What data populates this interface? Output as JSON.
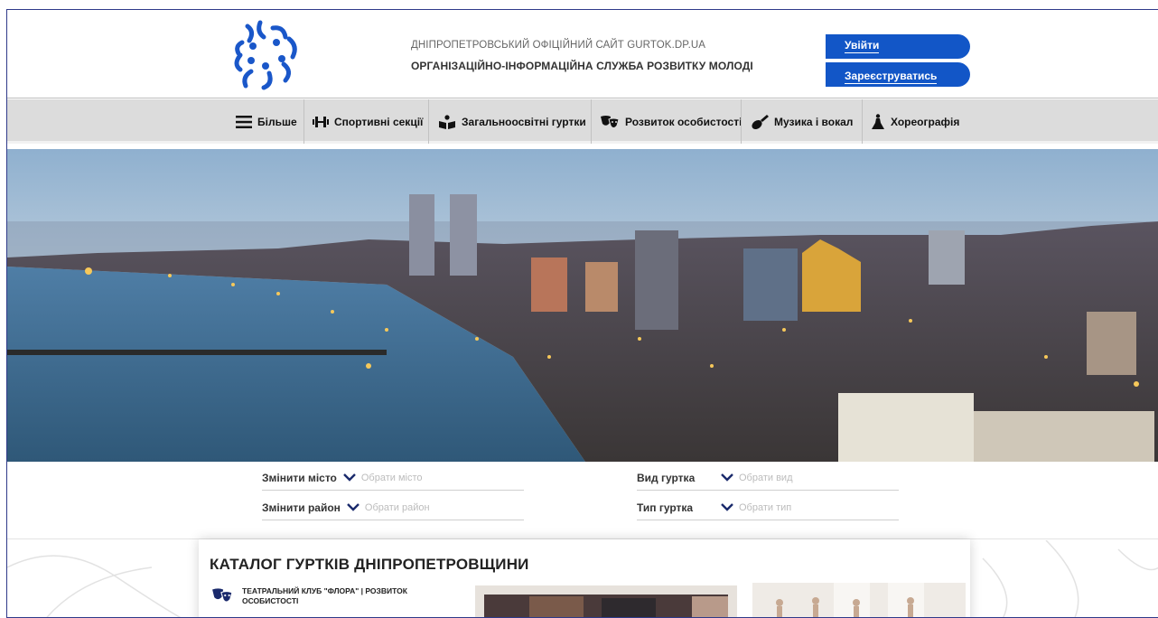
{
  "header": {
    "site_subtitle": "ДНІПРОПЕТРОВСЬКИЙ ОФІЦІЙНИЙ САЙТ GURTOK.DP.UA",
    "site_title": "ОРГАНІЗАЦІЙНО-ІНФОРМАЦІЙНА СЛУЖБА РОЗВИТКУ МОЛОДІ",
    "login_label": "Увійти",
    "register_label": "Зареєструватись",
    "brand_color": "#1256c7"
  },
  "nav": {
    "items": [
      {
        "label": "Більше",
        "icon": "menu-icon"
      },
      {
        "label": "Спортивні секції",
        "icon": "dumbbell-icon"
      },
      {
        "label": "Загальноосвітні гуртки",
        "icon": "reading-icon"
      },
      {
        "label": "Розвиток особистості",
        "icon": "theatre-masks-icon"
      },
      {
        "label": "Музика і вокал",
        "icon": "guitar-icon"
      },
      {
        "label": "Хореографія",
        "icon": "dancer-icon"
      }
    ]
  },
  "filters": {
    "city_label": "Змінити місто",
    "city_placeholder": "Обрати місто",
    "district_label": "Змінити район",
    "district_placeholder": "Обрати район",
    "kind_label": "Вид гуртка",
    "kind_placeholder": "Обрати вид",
    "type_label": "Тип гуртка",
    "type_placeholder": "Обрати тип"
  },
  "catalog": {
    "title": "КАТАЛОГ ГУРТКІВ ДНІПРОПЕТРОВЩИНИ",
    "club_name": "ТЕАТРАЛЬНИЙ КЛУБ \"ФЛОРА\" | РОЗВИТОК ОСОБИСТОСТІ",
    "club_icon": "theatre-masks-icon"
  }
}
